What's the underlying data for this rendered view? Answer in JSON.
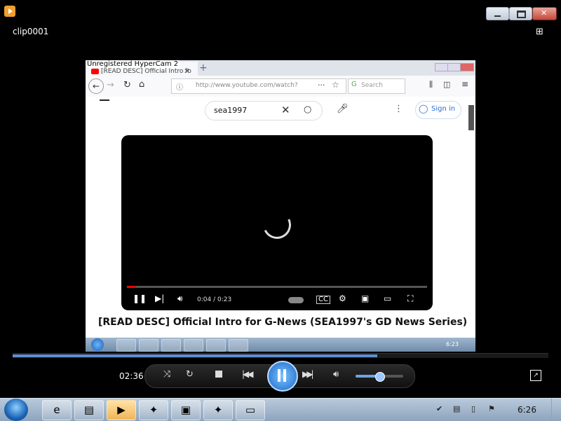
{
  "window": {
    "clip_title": "clip0001"
  },
  "recording": {
    "hypercam_watermark": "Unregistered HyperCam 2",
    "browser": {
      "tab_title": "[READ DESC] Official Intro fo",
      "url": "http://www.youtube.com/watch?",
      "search_placeholder": "Search"
    },
    "youtube": {
      "search_query": "sea1997",
      "sign_in_label": "Sign in",
      "video_time": "0:04 / 0:23",
      "video_title": "[READ DESC] Official Intro for G-News (SEA1997's GD News Series)",
      "video_progress_fraction": 0.03
    },
    "inner_clock": "6:23"
  },
  "player": {
    "elapsed_time": "02:36",
    "seek_fraction": 0.68,
    "volume_fraction": 0.5
  },
  "taskbar": {
    "clock": "6:26",
    "buttons": [
      {
        "name": "ie",
        "icon": "ie-icon",
        "glyph": "e"
      },
      {
        "name": "explorer",
        "icon": "folder-icon",
        "glyph": "▤"
      },
      {
        "name": "wmp",
        "icon": "media-player-icon",
        "glyph": "▶"
      },
      {
        "name": "app1",
        "icon": "app-icon",
        "glyph": "✦"
      },
      {
        "name": "app2",
        "icon": "monitor-icon",
        "glyph": "▣"
      },
      {
        "name": "app3",
        "icon": "app-icon",
        "glyph": "✦"
      },
      {
        "name": "app4",
        "icon": "window-icon",
        "glyph": "▭"
      }
    ]
  },
  "colors": {
    "accent": "#5f8fd0",
    "youtube_red": "#ff0000"
  }
}
